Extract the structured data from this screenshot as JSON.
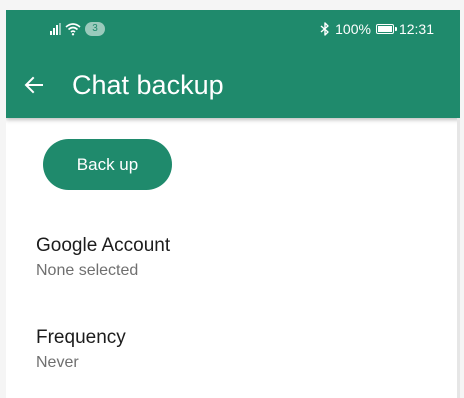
{
  "status_bar": {
    "notification_count": "3",
    "battery_level": "100%",
    "time": "12:31",
    "icons": [
      "signal-icon",
      "wifi-icon",
      "bluetooth-icon",
      "battery-icon"
    ]
  },
  "toolbar": {
    "title": "Chat backup",
    "back_icon": "back-arrow-icon"
  },
  "backup_button": {
    "label": "Back up"
  },
  "settings": {
    "google_account": {
      "title": "Google Account",
      "value": "None selected"
    },
    "frequency": {
      "title": "Frequency",
      "value": "Never"
    }
  },
  "colors": {
    "accent": "#1f8a6c",
    "title_text": "#1c1c1c",
    "secondary_text": "#6f6f6f"
  }
}
